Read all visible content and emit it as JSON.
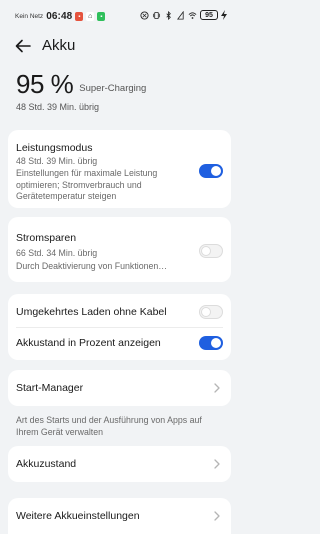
{
  "status_bar": {
    "network": "Kein Netz",
    "time": "06:48",
    "battery": "95"
  },
  "header": {
    "title": "Akku"
  },
  "summary": {
    "percent": "95 %",
    "charging": "Super-Charging",
    "remaining": "48 Std. 39 Min. übrig"
  },
  "performance_mode": {
    "title": "Leistungsmodus",
    "remaining": "48 Std. 39 Min. übrig",
    "description": "Einstellungen für maximale Leistung optimieren; Stromverbrauch und Gerätetemperatur steigen",
    "enabled": true
  },
  "power_saving": {
    "title": "Stromsparen",
    "remaining": "66 Std. 34 Min. übrig",
    "description": "Durch Deaktivierung von Funktionen…",
    "enabled": false
  },
  "reverse_wireless": {
    "title": "Umgekehrtes Laden ohne Kabel",
    "enabled": false
  },
  "show_percent": {
    "title": "Akkustand in Prozent anzeigen",
    "enabled": true
  },
  "start_manager": {
    "title": "Start-Manager",
    "caption": "Art des Starts und der Ausführung von Apps auf Ihrem Gerät verwalten"
  },
  "battery_health": {
    "title": "Akkuzustand"
  },
  "more_settings": {
    "title": "Weitere Akkueinstellungen"
  },
  "colors": {
    "accent": "#1f5fe0",
    "background": "#f1f3f5",
    "card": "#ffffff"
  }
}
